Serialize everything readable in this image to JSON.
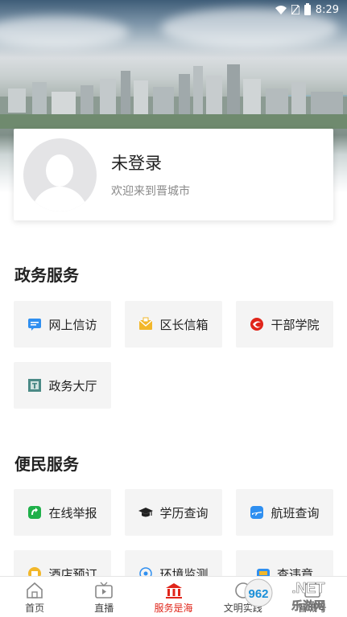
{
  "status_bar": {
    "time": "8:29"
  },
  "profile": {
    "login_status": "未登录",
    "welcome": "欢迎来到晋城市"
  },
  "gov_services": {
    "title": "政务服务",
    "items": [
      {
        "label": "网上信访",
        "icon": "petition-icon",
        "color": "#2f8ff0"
      },
      {
        "label": "区长信箱",
        "icon": "mailbox-icon",
        "color": "#f2b72a"
      },
      {
        "label": "干部学院",
        "icon": "academy-icon",
        "color": "#e0251a"
      },
      {
        "label": "政务大厅",
        "icon": "hall-icon",
        "color": "#4b8a86"
      }
    ]
  },
  "convenience_services": {
    "title": "便民服务",
    "items": [
      {
        "label": "在线举报",
        "icon": "report-icon",
        "color": "#1fb04a"
      },
      {
        "label": "学历查询",
        "icon": "graduation-cap-icon",
        "color": "#222222"
      },
      {
        "label": "航班查询",
        "icon": "flight-icon",
        "color": "#2f8ff0"
      },
      {
        "label": "酒店预订",
        "icon": "hotel-icon",
        "color": "#f2b72a"
      },
      {
        "label": "环境监测",
        "icon": "environment-icon",
        "color": "#2f8ff0"
      },
      {
        "label": "查违章",
        "icon": "violation-icon",
        "color": "#2f8ff0"
      }
    ]
  },
  "bottom_nav": {
    "items": [
      {
        "label": "首页",
        "icon": "home-icon"
      },
      {
        "label": "直播",
        "icon": "tv-icon"
      },
      {
        "label": "服务是海",
        "icon": "building-icon",
        "active": true
      },
      {
        "label": "文明实践",
        "icon": "practice-icon"
      },
      {
        "label": "晋城号",
        "icon": "account-icon"
      }
    ]
  },
  "watermark": {
    "text": "962.NET",
    "subtext": "乐游网"
  },
  "colors": {
    "accent": "#e0251a",
    "tile_bg": "#f4f4f4"
  }
}
